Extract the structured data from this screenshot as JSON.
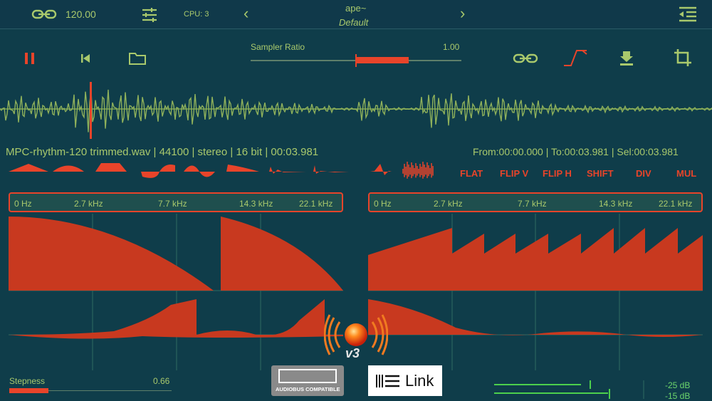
{
  "header": {
    "tempo": "120.00",
    "cpu": "CPU: 3",
    "plugin_name": "ape~",
    "preset": "Default"
  },
  "sampler": {
    "label": "Sampler Ratio",
    "value": "1.00",
    "fill": 0.25
  },
  "file_info": {
    "name": "MPC-rhythm-120 trimmed.wav | 44100 | stereo | 16 bit | 00:03.981",
    "range": "From:00:00.000 | To:00:03.981 | Sel:00:03.981"
  },
  "actions": [
    "FLAT",
    "FLIP V",
    "FLIP H",
    "SHIFT",
    "DIV",
    "MUL"
  ],
  "freq_left": [
    "0 Hz",
    "2.7 kHz",
    "7.7 kHz",
    "14.3 kHz",
    "22.1 kHz"
  ],
  "freq_right": [
    "0 Hz",
    "2.7 kHz",
    "7.7 kHz",
    "14.3 kHz",
    "22.1 kHz"
  ],
  "stepness": {
    "label": "Stepness",
    "value": "0.66",
    "fill": 0.24
  },
  "badges": {
    "audiobus": "AUDIOBUS COMPATIBLE",
    "link": "Link",
    "version": "v3"
  },
  "meters": {
    "top": "-25 dB",
    "bottom": "-15 dB"
  },
  "colors": {
    "accent": "#e8442a",
    "green": "#a9c96c",
    "bg": "#0f3d4a"
  }
}
